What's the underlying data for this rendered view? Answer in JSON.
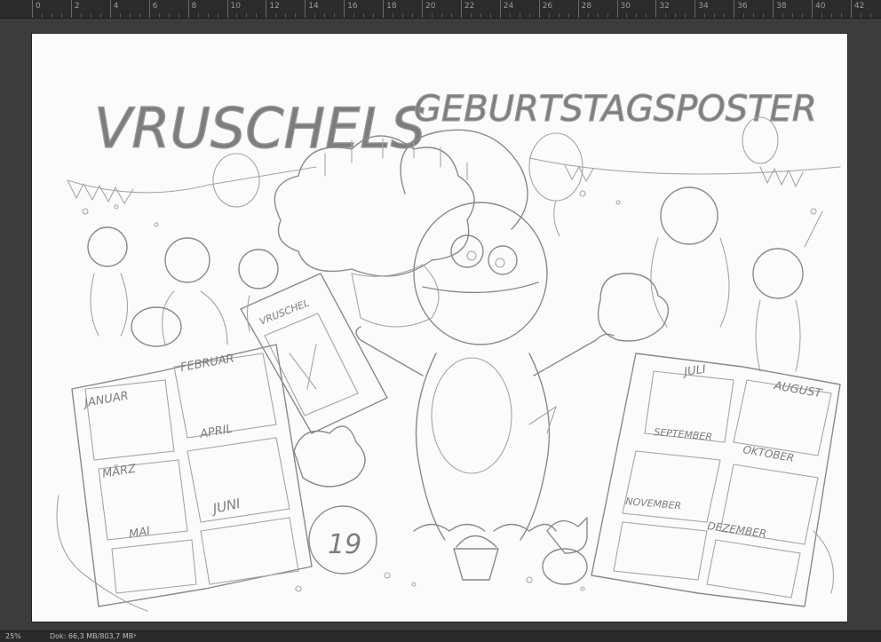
{
  "ruler": {
    "labels": [
      "0",
      "2",
      "4",
      "6",
      "8",
      "10",
      "12",
      "14",
      "16",
      "18",
      "20",
      "22",
      "24",
      "26",
      "28",
      "30",
      "32",
      "34",
      "36",
      "38",
      "40",
      "42"
    ]
  },
  "canvas": {
    "title_left": "VRUSCHELS",
    "title_right": "GEBURTSTAGSPOSTER",
    "sign_text": "VRUSCHEL",
    "number_badge": "19",
    "calendar_left": {
      "months": [
        "JANUAR",
        "FEBRUAR",
        "MÄRZ",
        "APRIL",
        "MAI",
        "JUNI"
      ]
    },
    "calendar_right": {
      "months": [
        "JULI",
        "AUGUST",
        "SEPTEMBER",
        "OKTOBER",
        "NOVEMBER",
        "DEZEMBER"
      ]
    }
  },
  "status_bar": {
    "zoom": "25%",
    "doc_info": "Dok: 66,3 MB/803,7 MB",
    "arrow": "›"
  },
  "colors": {
    "workspace": "#3a3a3a",
    "ruler": "#2b2b2b",
    "paper": "#fbfbfb",
    "pencil": "#8a8a8a"
  }
}
